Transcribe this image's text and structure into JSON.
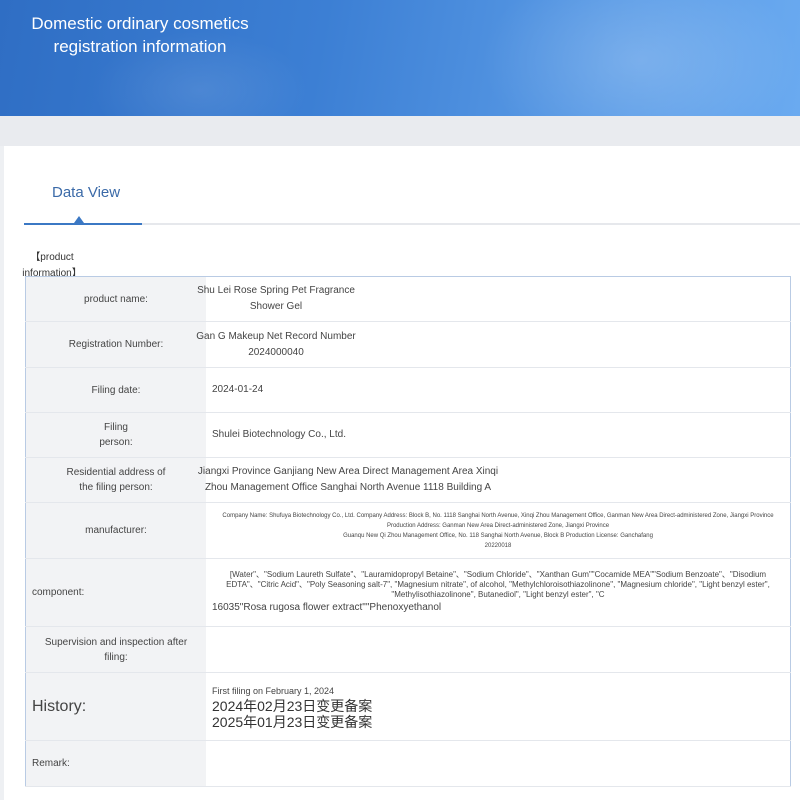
{
  "header": {
    "title": "Domestic ordinary cosmetics registration information"
  },
  "tabs": [
    {
      "label": "Data View"
    }
  ],
  "section": {
    "heading": "【product information】"
  },
  "rows": {
    "product_name": {
      "label": "product name:",
      "value": "Shu Lei Rose Spring Pet Fragrance Shower Gel"
    },
    "registration_number": {
      "label": "Registration Number:",
      "value": "Gan G Makeup Net Record Number 2024000040"
    },
    "filing_date": {
      "label": "Filing date:",
      "value": "2024-01-24"
    },
    "filing_person": {
      "label": "Filing person:",
      "value": "Shulei Biotechnology Co., Ltd."
    },
    "residential_address": {
      "label": "Residential address of the filing person:",
      "value": "Jiangxi Province Ganjiang New Area Direct Management Area Xinqi Zhou Management Office Sanghai North Avenue 1118 Building A"
    },
    "manufacturer": {
      "label": "manufacturer:",
      "line1": "Company Name: Shufuya Biotechnology Co., Ltd. Company Address: Block B, No. 1118 Sanghai North Avenue, Xinqi Zhou Management Office, Ganman New Area Direct-administered Zone, Jiangxi Province Production Address: Ganman New Area Direct-administered Zone, Jiangxi Province",
      "line2": "Guanqu New Qi Zhou Management Office, No. 118 Sanghai North Avenue, Block B Production License: Ganchafang",
      "line3": "20220018"
    },
    "component": {
      "label": "component:",
      "line1": "[Water\"、\"Sodium Laureth Sulfate\"、\"Lauramidopropyl Betaine\"、\"Sodium Chloride\"、\"Xanthan Gum\"\"Cocamide MEA\"\"Sodium Benzoate\"、\"Disodium EDTA\"、\"Citric Acid\"、\"Poly Seasoning salt-7\", \"Magnesium nitrate\", of alcohol, \"Methylchloroisothiazolinone\", \"Magnesium chloride\", \"Light benzyl ester\", \"Methylisothiazolinone\", Butanediol\", \"Light benzyl ester\", \"C",
      "line2": "16035\"Rosa rugosa flower extract\"\"Phenoxyethanol"
    },
    "supervision": {
      "label": "Supervision and inspection after filing:",
      "value": ""
    },
    "history": {
      "label": "History:",
      "first_filing": "First filing on February 1, 2024",
      "entry1": "2024年02月23日变更备案",
      "entry2": "2025年01月23日变更备案"
    },
    "remark": {
      "label": "Remark:",
      "value": ""
    }
  }
}
